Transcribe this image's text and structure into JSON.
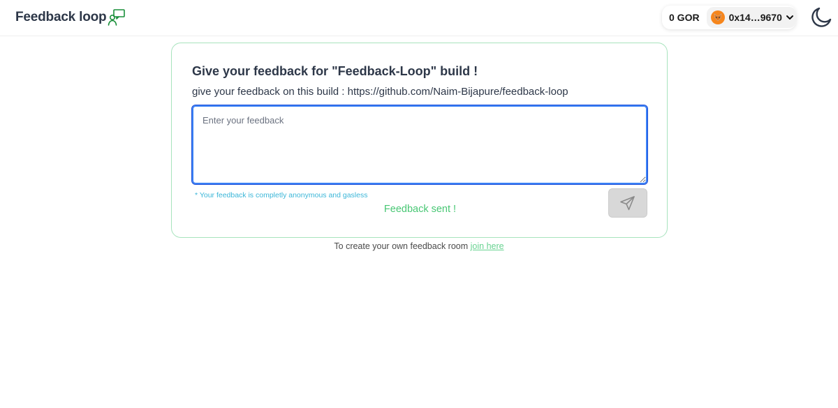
{
  "header": {
    "brand": "Feedback loop",
    "brand_icon": "chat-person-icon",
    "balance": "0 GOR",
    "account": "0x14…9670",
    "avatar_icon": "metamask-fox-icon",
    "theme_icon": "moon-icon"
  },
  "card": {
    "title": "Give your feedback for \"Feedback-Loop\" build !",
    "subtitle": "give your feedback on this build : https://github.com/Naim-Bijapure/feedback-loop",
    "input": {
      "placeholder": "Enter your feedback",
      "value": ""
    },
    "note": "* Your feedback is completly anonymous and gasless",
    "status": "Feedback sent !",
    "send_icon": "send-icon"
  },
  "footer": {
    "text": "To create your own feedback room",
    "link": "join here"
  },
  "colors": {
    "accent_green": "#48c774",
    "card_border": "#a7e3bd",
    "focus_blue": "#3b82f6",
    "note_cyan": "#3bb6d8"
  }
}
